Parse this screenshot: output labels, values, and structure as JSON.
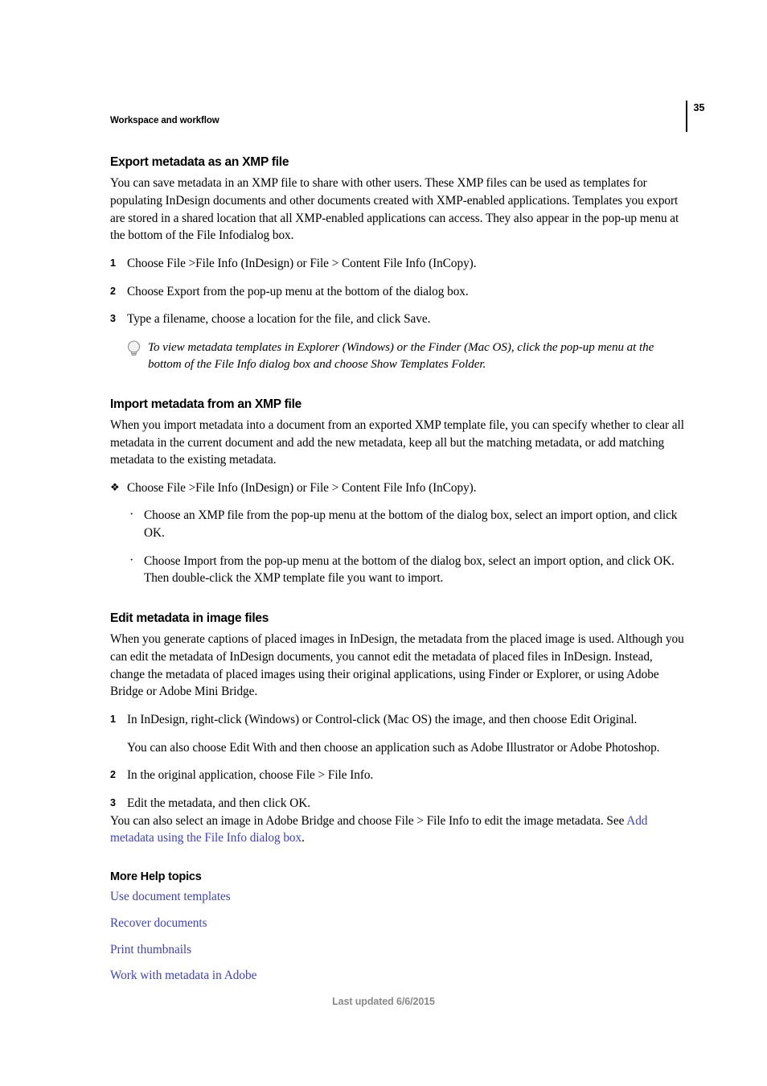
{
  "header": {
    "running_title": "Workspace and workflow",
    "page_number": "35"
  },
  "sections": {
    "export": {
      "heading": "Export metadata as an XMP file",
      "intro": "You can save metadata in an XMP file to share with other users. These XMP files can be used as templates for populating InDesign documents and other documents created with XMP-enabled applications. Templates you export are stored in a shared location that all XMP-enabled applications can access. They also appear in the pop-up menu at the bottom of the File Infodialog box.",
      "steps": [
        {
          "num": "1",
          "text": "Choose File >File Info (InDesign) or File > Content File Info (InCopy)."
        },
        {
          "num": "2",
          "text": "Choose Export from the pop-up menu at the bottom of the dialog box."
        },
        {
          "num": "3",
          "text": "Type a filename, choose a location for the file, and click Save."
        }
      ],
      "tip": {
        "icon": "lightbulb-icon",
        "text": "To view metadata templates in Explorer (Windows) or the Finder (Mac OS), click the pop-up menu at the bottom of the File Info dialog box and choose Show Templates Folder."
      }
    },
    "import": {
      "heading": "Import metadata from an XMP file",
      "intro": "When you import metadata into a document from an exported XMP template file, you can specify whether to clear all metadata in the current document and add the new metadata, keep all but the matching metadata, or add matching metadata to the existing metadata.",
      "action_marker": "❖",
      "action": "Choose File >File Info (InDesign) or File > Content File Info (InCopy).",
      "bullet_marker": "·",
      "bullets": [
        "Choose an XMP file from the pop-up menu at the bottom of the dialog box, select an import option, and click OK.",
        "Choose Import from the pop-up menu at the bottom of the dialog box, select an import option, and click OK. Then double-click the XMP template file you want to import."
      ]
    },
    "edit": {
      "heading": "Edit metadata in image files",
      "intro": "When you generate captions of placed images in InDesign, the metadata from the placed image is used. Although you can edit the metadata of InDesign documents, you cannot edit the metadata of placed files in InDesign. Instead, change the metadata of placed images using their original applications, using Finder or Explorer, or using Adobe Bridge or Adobe Mini Bridge.",
      "steps": [
        {
          "num": "1",
          "text": "In InDesign, right-click (Windows) or Control-click (Mac OS) the image, and then choose Edit Original.",
          "sub": "You can also choose Edit With and then choose an application such as Adobe Illustrator or Adobe Photoshop."
        },
        {
          "num": "2",
          "text": "In the original application, choose File > File Info."
        },
        {
          "num": "3",
          "text": "Edit the metadata, and then click OK."
        }
      ],
      "closing_prefix": "You can also select an image in Adobe Bridge and choose File > File Info to edit the image metadata. See ",
      "closing_link": "Add metadata using the File Info dialog box",
      "closing_suffix": "."
    }
  },
  "more_help": {
    "heading": "More Help topics",
    "links": [
      "Use document templates",
      "Recover documents",
      "Print thumbnails",
      "Work with metadata in Adobe"
    ]
  },
  "footer": {
    "text": "Last updated 6/6/2015"
  },
  "colors": {
    "link": "#3c41c8",
    "footer_text": "#898989",
    "body_text": "#000000"
  }
}
